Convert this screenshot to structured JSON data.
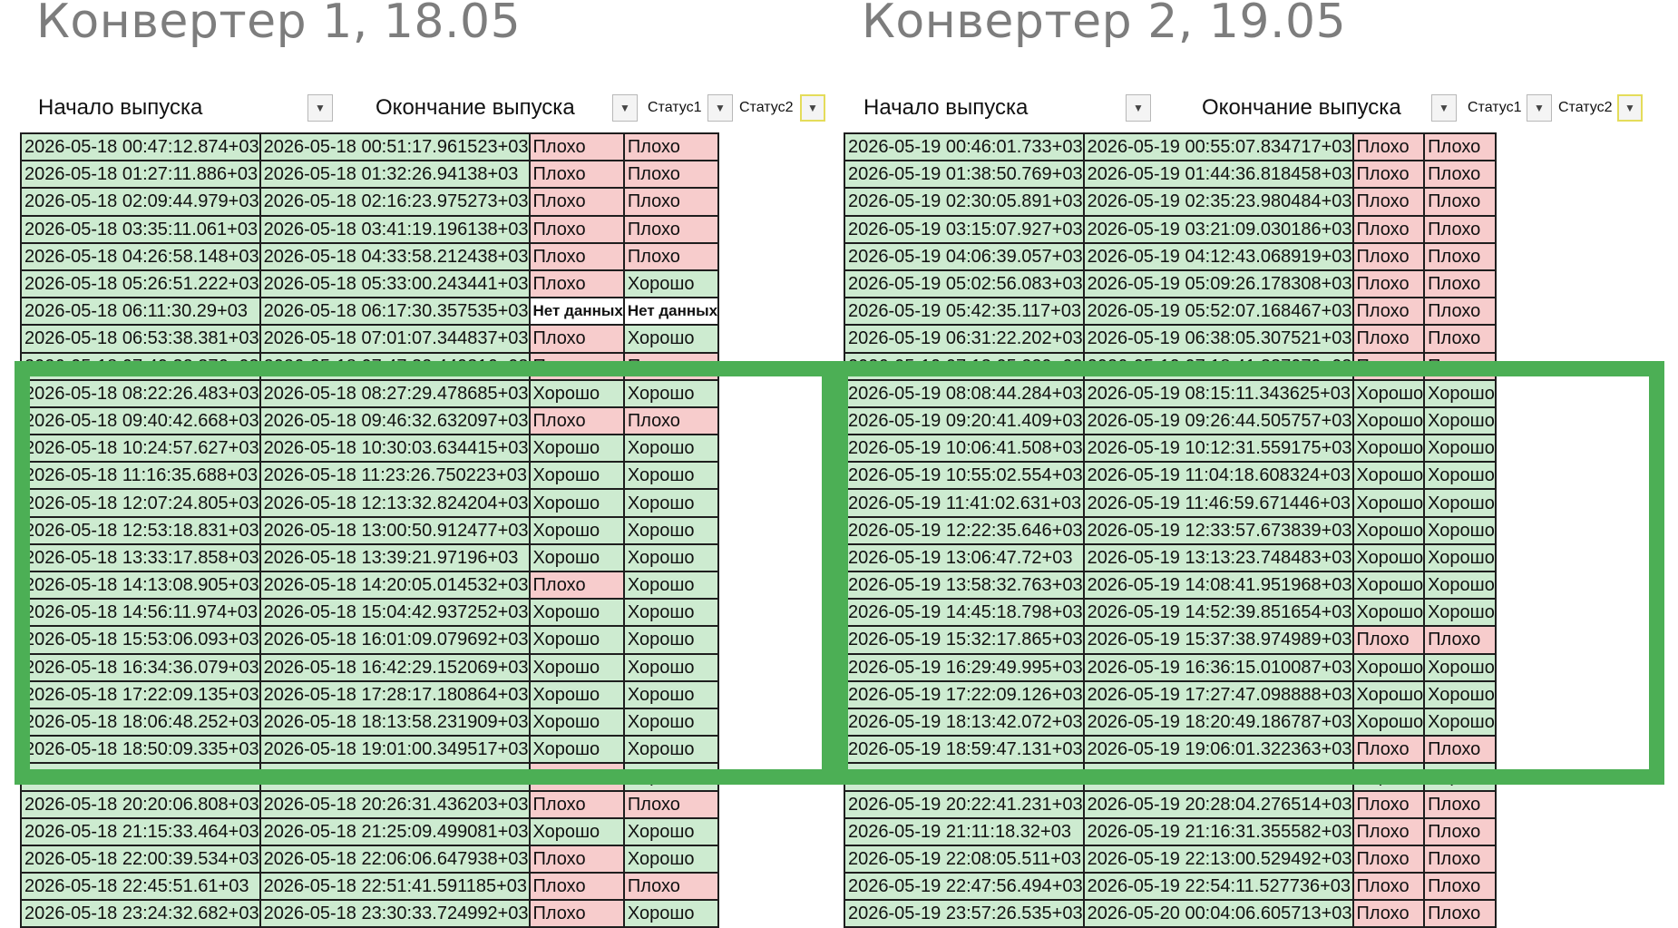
{
  "titles": [
    "Конвертер 1, 18.05",
    "Конвертер 2, 19.05"
  ],
  "headers": {
    "start": "Начало выпуска",
    "end": "Окончание выпуска",
    "status1": "Статус1",
    "status2": "Статус2"
  },
  "colors": {
    "title": "#7d7d7d",
    "good_fill": "#cdebd0",
    "bad_fill": "#f7cccc",
    "highlight_frame": "#4caf55"
  },
  "table1": [
    [
      "2026-05-18 00:47:12.874+03",
      "2026-05-18 00:51:17.961523+03",
      "Плохо",
      "Плохо"
    ],
    [
      "2026-05-18 01:27:11.886+03",
      "2026-05-18 01:32:26.94138+03",
      "Плохо",
      "Плохо"
    ],
    [
      "2026-05-18 02:09:44.979+03",
      "2026-05-18 02:16:23.975273+03",
      "Плохо",
      "Плохо"
    ],
    [
      "2026-05-18 03:35:11.061+03",
      "2026-05-18 03:41:19.196138+03",
      "Плохо",
      "Плохо"
    ],
    [
      "2026-05-18 04:26:58.148+03",
      "2026-05-18 04:33:58.212438+03",
      "Плохо",
      "Плохо"
    ],
    [
      "2026-05-18 05:26:51.222+03",
      "2026-05-18 05:33:00.243441+03",
      "Плохо",
      "Хорошо"
    ],
    [
      "2026-05-18 06:11:30.29+03",
      "2026-05-18 06:17:30.357535+03",
      "Нет данных",
      "Нет данных"
    ],
    [
      "2026-05-18 06:53:38.381+03",
      "2026-05-18 07:01:07.344837+03",
      "Плохо",
      "Хорошо"
    ],
    [
      "2026-05-18 07:40:32.376+03",
      "2026-05-18 07:47:32.449316+03",
      "Плохо",
      "Плохо"
    ],
    [
      "2026-05-18 08:22:26.483+03",
      "2026-05-18 08:27:29.478685+03",
      "Хорошо",
      "Хорошо"
    ],
    [
      "2026-05-18 09:40:42.668+03",
      "2026-05-18 09:46:32.632097+03",
      "Плохо",
      "Плохо"
    ],
    [
      "2026-05-18 10:24:57.627+03",
      "2026-05-18 10:30:03.634415+03",
      "Хорошо",
      "Хорошо"
    ],
    [
      "2026-05-18 11:16:35.688+03",
      "2026-05-18 11:23:26.750223+03",
      "Хорошо",
      "Хорошо"
    ],
    [
      "2026-05-18 12:07:24.805+03",
      "2026-05-18 12:13:32.824204+03",
      "Хорошо",
      "Хорошо"
    ],
    [
      "2026-05-18 12:53:18.831+03",
      "2026-05-18 13:00:50.912477+03",
      "Хорошо",
      "Хорошо"
    ],
    [
      "2026-05-18 13:33:17.858+03",
      "2026-05-18 13:39:21.97196+03",
      "Хорошо",
      "Хорошо"
    ],
    [
      "2026-05-18 14:13:08.905+03",
      "2026-05-18 14:20:05.014532+03",
      "Плохо",
      "Хорошо"
    ],
    [
      "2026-05-18 14:56:11.974+03",
      "2026-05-18 15:04:42.937252+03",
      "Хорошо",
      "Хорошо"
    ],
    [
      "2026-05-18 15:53:06.093+03",
      "2026-05-18 16:01:09.079692+03",
      "Хорошо",
      "Хорошо"
    ],
    [
      "2026-05-18 16:34:36.079+03",
      "2026-05-18 16:42:29.152069+03",
      "Хорошо",
      "Хорошо"
    ],
    [
      "2026-05-18 17:22:09.135+03",
      "2026-05-18 17:28:17.180864+03",
      "Хорошо",
      "Хорошо"
    ],
    [
      "2026-05-18 18:06:48.252+03",
      "2026-05-18 18:13:58.231909+03",
      "Хорошо",
      "Хорошо"
    ],
    [
      "2026-05-18 18:50:09.335+03",
      "2026-05-18 19:01:00.349517+03",
      "Хорошо",
      "Хорошо"
    ],
    [
      "2026-05-18 19:34:30.363+03",
      "2026-05-18 19:51:15.429847+03",
      "Плохо",
      "Хорошо"
    ],
    [
      "2026-05-18 20:20:06.808+03",
      "2026-05-18 20:26:31.436203+03",
      "Плохо",
      "Плохо"
    ],
    [
      "2026-05-18 21:15:33.464+03",
      "2026-05-18 21:25:09.499081+03",
      "Хорошо",
      "Хорошо"
    ],
    [
      "2026-05-18 22:00:39.534+03",
      "2026-05-18 22:06:06.647938+03",
      "Плохо",
      "Хорошо"
    ],
    [
      "2026-05-18 22:45:51.61+03",
      "2026-05-18 22:51:41.591185+03",
      "Плохо",
      "Плохо"
    ],
    [
      "2026-05-18 23:24:32.682+03",
      "2026-05-18 23:30:33.724992+03",
      "Плохо",
      "Хорошо"
    ]
  ],
  "table2": [
    [
      "2026-05-19 00:46:01.733+03",
      "2026-05-19 00:55:07.834717+03",
      "Плохо",
      "Плохо"
    ],
    [
      "2026-05-19 01:38:50.769+03",
      "2026-05-19 01:44:36.818458+03",
      "Плохо",
      "Плохо"
    ],
    [
      "2026-05-19 02:30:05.891+03",
      "2026-05-19 02:35:23.980484+03",
      "Плохо",
      "Плохо"
    ],
    [
      "2026-05-19 03:15:07.927+03",
      "2026-05-19 03:21:09.030186+03",
      "Плохо",
      "Плохо"
    ],
    [
      "2026-05-19 04:06:39.057+03",
      "2026-05-19 04:12:43.068919+03",
      "Плохо",
      "Плохо"
    ],
    [
      "2026-05-19 05:02:56.083+03",
      "2026-05-19 05:09:26.178308+03",
      "Плохо",
      "Плохо"
    ],
    [
      "2026-05-19 05:42:35.117+03",
      "2026-05-19 05:52:07.168467+03",
      "Плохо",
      "Плохо"
    ],
    [
      "2026-05-19 06:31:22.202+03",
      "2026-05-19 06:38:05.307521+03",
      "Плохо",
      "Плохо"
    ],
    [
      "2026-05-19 07:13:05.229+03",
      "2026-05-19 07:18:41.337079+03",
      "Плохо",
      "Плохо"
    ],
    [
      "2026-05-19 08:08:44.284+03",
      "2026-05-19 08:15:11.343625+03",
      "Хорошо",
      "Хорошо"
    ],
    [
      "2026-05-19 09:20:41.409+03",
      "2026-05-19 09:26:44.505757+03",
      "Хорошо",
      "Хорошо"
    ],
    [
      "2026-05-19 10:06:41.508+03",
      "2026-05-19 10:12:31.559175+03",
      "Хорошо",
      "Хорошо"
    ],
    [
      "2026-05-19 10:55:02.554+03",
      "2026-05-19 11:04:18.608324+03",
      "Хорошо",
      "Хорошо"
    ],
    [
      "2026-05-19 11:41:02.631+03",
      "2026-05-19 11:46:59.671446+03",
      "Хорошо",
      "Хорошо"
    ],
    [
      "2026-05-19 12:22:35.646+03",
      "2026-05-19 12:33:57.673839+03",
      "Хорошо",
      "Хорошо"
    ],
    [
      "2026-05-19 13:06:47.72+03",
      "2026-05-19 13:13:23.748483+03",
      "Хорошо",
      "Хорошо"
    ],
    [
      "2026-05-19 13:58:32.763+03",
      "2026-05-19 14:08:41.951968+03",
      "Хорошо",
      "Хорошо"
    ],
    [
      "2026-05-19 14:45:18.798+03",
      "2026-05-19 14:52:39.851654+03",
      "Хорошо",
      "Хорошо"
    ],
    [
      "2026-05-19 15:32:17.865+03",
      "2026-05-19 15:37:38.974989+03",
      "Плохо",
      "Плохо"
    ],
    [
      "2026-05-19 16:29:49.995+03",
      "2026-05-19 16:36:15.010087+03",
      "Хорошо",
      "Хорошо"
    ],
    [
      "2026-05-19 17:22:09.126+03",
      "2026-05-19 17:27:47.098888+03",
      "Хорошо",
      "Хорошо"
    ],
    [
      "2026-05-19 18:13:42.072+03",
      "2026-05-19 18:20:49.186787+03",
      "Хорошо",
      "Хорошо"
    ],
    [
      "2026-05-19 18:59:47.131+03",
      "2026-05-19 19:06:01.322363+03",
      "Плохо",
      "Плохо"
    ],
    [
      "2026-05-19 19:40:24.182+03",
      "2026-05-19 19:45:19.220068+03",
      "Хорошо",
      "Хорошо"
    ],
    [
      "2026-05-19 20:22:41.231+03",
      "2026-05-19 20:28:04.276514+03",
      "Плохо",
      "Плохо"
    ],
    [
      "2026-05-19 21:11:18.32+03",
      "2026-05-19 21:16:31.355582+03",
      "Плохо",
      "Плохо"
    ],
    [
      "2026-05-19 22:08:05.511+03",
      "2026-05-19 22:13:00.529492+03",
      "Плохо",
      "Плохо"
    ],
    [
      "2026-05-19 22:47:56.494+03",
      "2026-05-19 22:54:11.527736+03",
      "Плохо",
      "Плохо"
    ],
    [
      "2026-05-19 23:57:26.535+03",
      "2026-05-20 00:04:06.605713+03",
      "Плохо",
      "Плохо"
    ]
  ]
}
